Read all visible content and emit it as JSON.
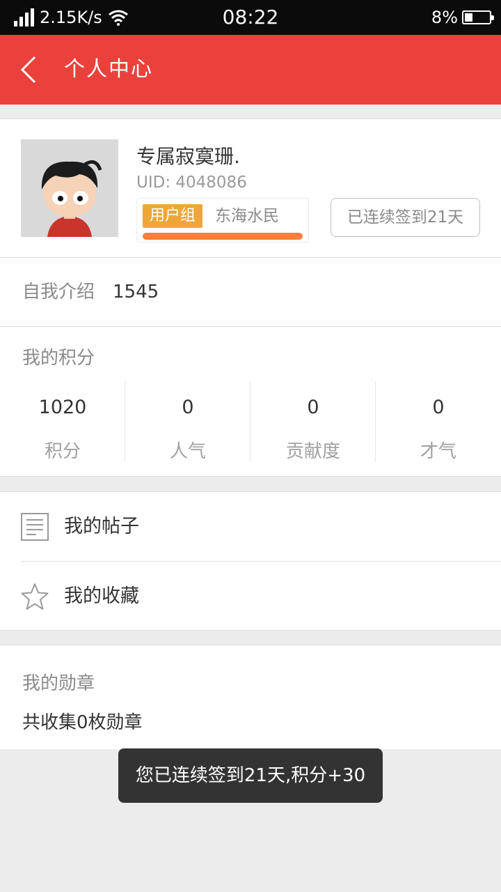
{
  "status_bar": {
    "speed": "2.15K/s",
    "time": "08:22",
    "battery": "8%",
    "battery_level": 0.08
  },
  "app_bar": {
    "title": "个人中心"
  },
  "profile": {
    "username": "专属寂寞珊.",
    "uid": "UID: 4048086",
    "group_badge": "用户组",
    "group_name": "东海水民",
    "signin_label": "已连续签到21天"
  },
  "intro": {
    "label": "自我介绍",
    "value": "1545"
  },
  "points": {
    "title": "我的积分",
    "stats": [
      {
        "value": "1020",
        "label": "积分"
      },
      {
        "value": "0",
        "label": "人气"
      },
      {
        "value": "0",
        "label": "贡献度"
      },
      {
        "value": "0",
        "label": "才气"
      }
    ]
  },
  "menu": {
    "posts": "我的帖子",
    "favorites": "我的收藏"
  },
  "medals": {
    "title": "我的勋章",
    "count_text": "共收集0枚勋章"
  },
  "toast": {
    "message": "您已连续签到21天,积分+30"
  },
  "colors": {
    "primary": "#ea413d",
    "badge": "#efa637",
    "progress": "#f97e3e"
  },
  "icons": [
    "signal-icon",
    "wifi-icon",
    "battery-icon",
    "back-arrow-icon",
    "avatar-image",
    "document-icon",
    "star-icon"
  ]
}
